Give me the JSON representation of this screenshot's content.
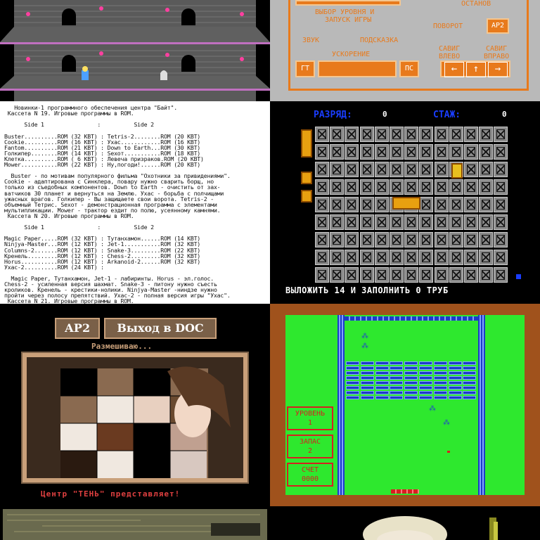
{
  "tile_menu": {
    "select_label_1": "ВЫБОР УРОВНЯ И",
    "select_label_2": "ЗАПУСК ИГРЫ",
    "stop_label": "ОСТАНОВ",
    "rotate_label": "ПОВОРОТ",
    "ar2_btn": "АР2",
    "sound_label": "ЗВУК",
    "hint_label": "ПОДСКАЗКА",
    "accel_label": "УСКОРЕНИЕ",
    "shift_left_label": "САВИГ\nВЛЕВО",
    "shift_right_label": "САВИГ\nВПРАВО",
    "gt_btn": "ГТ",
    "ps_btn": "ПС",
    "arrow_left": "←",
    "arrow_up": "↑",
    "arrow_right": "→"
  },
  "tile_doc": {
    "lines": [
      "   Новинки-1 программного обеспечения центра \"Байт\".",
      " Кассета N 19. Игровые программы в ROM.",
      "",
      "      Side 1                :          Side 2",
      "",
      "Buster..........ROM (32 KBT) : Tetris-2........ROM (20 KBT)",
      "Cookie..........ROM (16 KBT) : Ухас............ROM (16 KBT)",
      "Fantom..........ROM (21 KBT) : Down to Earth...ROM (30 KBT)",
      "Голкипер........ROM (14 KBT) : Sexoт...........ROM (18 KBT)",
      "Клетка..........ROM ( 6 KBT) : Левеча призраков.ROM (20 KBT)",
      "Mower...........ROM (22 KBT) : Ну,погоди!......ROM (20 KBT)",
      "",
      "  Buster - по мотивам популярного фильма \"Охотники за привидениями\".",
      "Cookie - адаптирована с Синклера, повару нужно сварить борщ, но",
      "только из съедобных компонентов. Down to Earth - очистить от зах-",
      "ватчиков 30 планет и вернуться на Землю. Ухас - борьба с полчищами",
      "ужасных врагов. Голкипер - Вы защищаете свои ворота. Tetris-2 -",
      "объемный Тетрис. Sexoт - демонстрационная программа с элементами",
      "мультипликации. Mower - трактор ездит по полю, усеянному камнями.",
      " Кассета N 20. Игровые программы в ROM.",
      "",
      "      Side 1                :          Side 2",
      "",
      "Magic Paper.....ROM (32 KBT) : Тутанхамон......ROM (14 KBT)",
      "Ninjya-Master...ROM (12 KBT) : Jet-1...........ROM (32 KBT)",
      "Columns-2.......ROM (12 KBT) : Snake-3.........ROM (22 KBT)",
      "Кренель.........ROM (12 KBT) : Chess-2.........ROM (32 KBT)",
      "Horus...........ROM (12 KBT) : Arkanoid-2......ROM (32 KBT)",
      "Ухас-2..........ROM (24 KBT) :",
      "",
      "  Magic Paper, Тутанхамон, Jet-1 - лабиринты. Horus - эл.голос.",
      "Chess-2 - усиленная версия шахмат. Snake-3 - питону нужно съесть",
      "кроликов. Кренель - крестики-нолики. Ninjya-Master -ниндзе нужно",
      "пройти через полосу препятствий. Ухас-2 - полная версия игры \"Ухас\".",
      " Кассета N 21. Игровые программы в ROM."
    ]
  },
  "tile_pipes": {
    "level_label": "РАЗРЯД:",
    "level_value": "0",
    "stage_label": "СТАЖ:",
    "stage_value": "0",
    "footer": "ВЫЛОЖИТЬ 14 И ЗАПОЛНИТЬ  0 ТРУБ"
  },
  "tile_puzzle": {
    "ar2_btn": "АР2",
    "exit_btn": "Выход в DOC",
    "status": "Размешиваю...",
    "footer": "Центр \"ТЕНЬ\" представляет!"
  },
  "tile_arkanoid": {
    "level_label": "УРОВЕНЬ",
    "level_value": "1",
    "lives_label": "ЗАПАС",
    "lives_value": "2",
    "score_label": "СЧЕТ",
    "score_value": "0000"
  },
  "colors": {
    "menu_orange": "#e87a1c",
    "pipe_blue": "#1a3dff",
    "arkanoid_green": "#2ee82e",
    "arkanoid_red": "#d62020",
    "puzzle_frame": "#c9a07a"
  }
}
